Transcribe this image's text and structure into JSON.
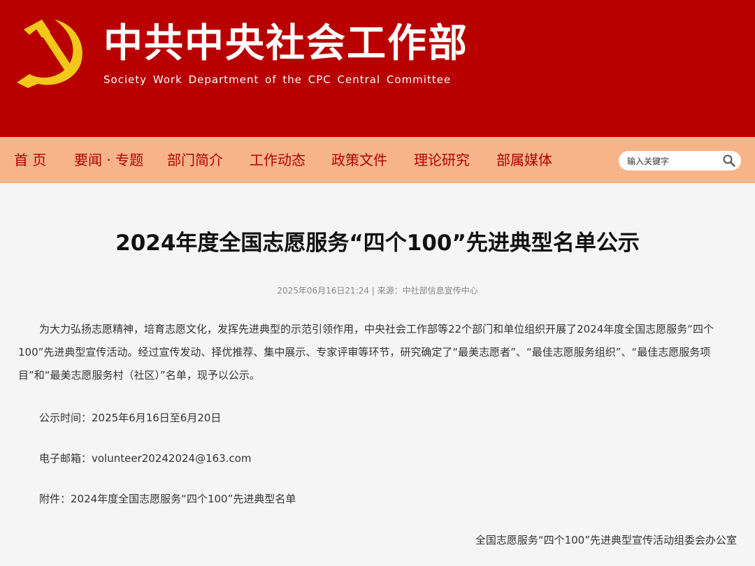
{
  "header": {
    "title": "中共中央社会工作部",
    "subtitle": "Society Work Department of the CPC Central Committee",
    "emblem_icon": "hammer-sickle-icon",
    "background_color": "#b80000",
    "emblem_color": "#f2c81a"
  },
  "nav": {
    "background_color": "#f8b489",
    "text_color": "#b20000",
    "items": [
      {
        "label": "首  页"
      },
      {
        "label": "要闻 · 专题"
      },
      {
        "label": "部门简介"
      },
      {
        "label": "工作动态"
      },
      {
        "label": "政策文件"
      },
      {
        "label": "理论研究"
      },
      {
        "label": "部属媒体"
      }
    ]
  },
  "search": {
    "placeholder": "输入关键字",
    "icon": "search-icon"
  },
  "article": {
    "title": "2024年度全国志愿服务“四个100”先进典型名单公示",
    "meta": "2025年06月16日21:24 | 来源：中社部信息宣传中心",
    "paragraph": "为大力弘扬志愿精神，培育志愿文化，发挥先进典型的示范引领作用，中央社会工作部等22个部门和单位组织开展了2024年度全国志愿服务“四个100”先进典型宣传活动。经过宣传发动、择优推荐、集中展示、专家评审等环节，研究确定了“最美志愿者”、“最佳志愿服务组织”、“最佳志愿服务项目”和“最美志愿服务村（社区）”名单，现予以公示。",
    "period": "公示时间：2025年6月16日至6月20日",
    "email": "电子邮箱：volunteer20242024@163.com",
    "attachment": "附件：2024年度全国志愿服务“四个100”先进典型名单",
    "signature": "全国志愿服务“四个100”先进典型宣传活动组委会办公室"
  }
}
